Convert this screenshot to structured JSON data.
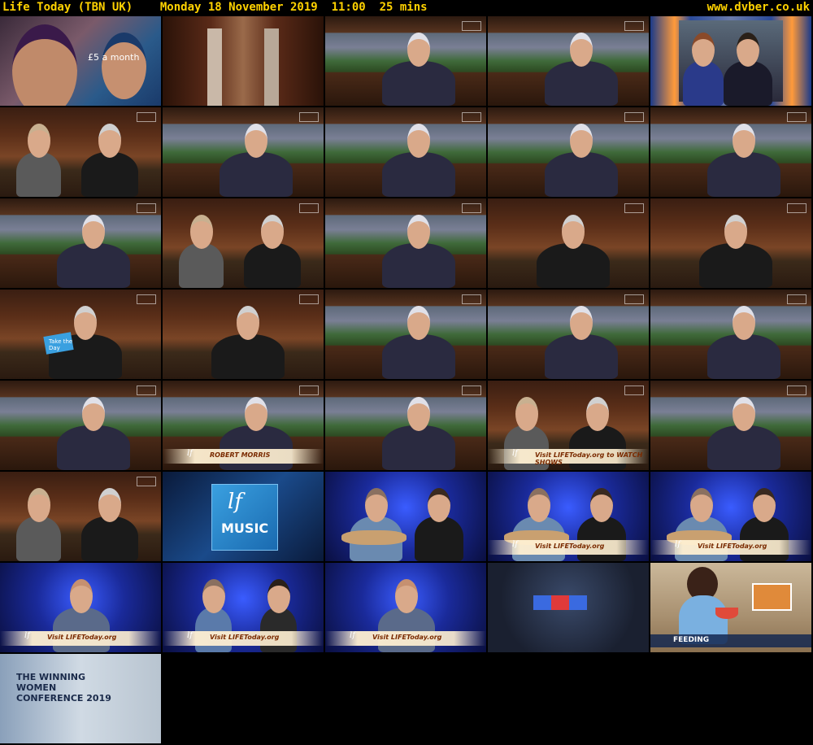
{
  "header": {
    "title": "Life Today (TBN UK)    Monday 18 November 2019  11:00  25 mins",
    "site": "www.dvber.co.uk"
  },
  "tiles": [
    {
      "scene": "charity",
      "overlay": "£5 a month"
    },
    {
      "scene": "set-empty"
    },
    {
      "scene": "host-solo"
    },
    {
      "scene": "host-solo"
    },
    {
      "scene": "studio-audience"
    },
    {
      "scene": "couple"
    },
    {
      "scene": "host-solo"
    },
    {
      "scene": "host-solo"
    },
    {
      "scene": "host-solo"
    },
    {
      "scene": "host-solo"
    },
    {
      "scene": "host-solo"
    },
    {
      "scene": "couple"
    },
    {
      "scene": "host-solo"
    },
    {
      "scene": "guest-solo"
    },
    {
      "scene": "guest-solo"
    },
    {
      "scene": "guest-book",
      "overlay": "Take the Day"
    },
    {
      "scene": "guest-solo"
    },
    {
      "scene": "host-solo"
    },
    {
      "scene": "host-solo"
    },
    {
      "scene": "host-solo"
    },
    {
      "scene": "host-solo"
    },
    {
      "scene": "host-lower",
      "overlay": "ROBERT MORRIS"
    },
    {
      "scene": "host-solo"
    },
    {
      "scene": "couple-lower",
      "overlay": "Visit LIFEToday.org to WATCH SHOWS"
    },
    {
      "scene": "host-solo"
    },
    {
      "scene": "couple"
    },
    {
      "scene": "lf-music",
      "overlay": "MUSIC"
    },
    {
      "scene": "band-blue"
    },
    {
      "scene": "band-blue-lower",
      "overlay": "Visit LIFEToday.org"
    },
    {
      "scene": "band-blue-lower",
      "overlay": "Visit LIFEToday.org"
    },
    {
      "scene": "singer-lower",
      "overlay": "Visit LIFEToday.org"
    },
    {
      "scene": "band-wide-lower",
      "overlay": "Visit LIFEToday.org"
    },
    {
      "scene": "singer-lower",
      "overlay": "Visit LIFEToday.org"
    },
    {
      "scene": "bumper"
    },
    {
      "scene": "feeding",
      "overlay": "FEEDING"
    },
    {
      "scene": "conference",
      "overlay": "THE WINNING WOMEN CONFERENCE 2019"
    }
  ]
}
